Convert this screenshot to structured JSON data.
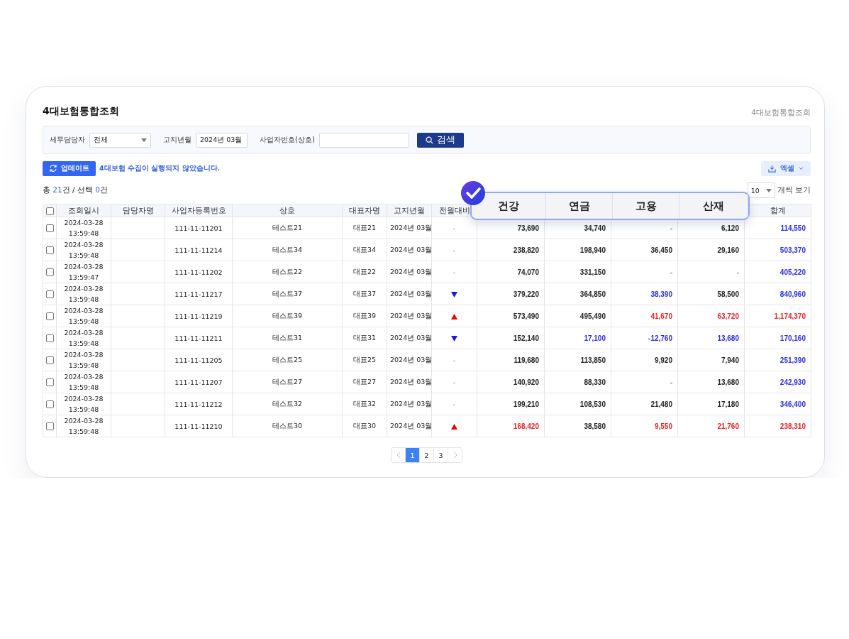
{
  "page": {
    "title": "4대보험통합조회",
    "breadcrumb": "4대보험통합조회"
  },
  "filters": {
    "manager": {
      "label": "세무담당자",
      "value": "전체"
    },
    "month": {
      "label": "고지년월",
      "value": "2024년 03월"
    },
    "business": {
      "label": "사업자번호(상호)"
    },
    "search_button": "검색"
  },
  "update_button": "업데이트",
  "status_message": "4대보험 수집이 실행되지 않았습니다.",
  "excel_button": "엑셀",
  "count": [
    {
      "text": "총 ",
      "accent": false
    },
    {
      "text": "21",
      "accent": true
    },
    {
      "text": "건 / 선택 ",
      "accent": false
    },
    {
      "text": "0",
      "accent": true
    },
    {
      "text": "건",
      "accent": false
    }
  ],
  "page_size": {
    "value": "10",
    "label": "개씩 보기"
  },
  "table": {
    "select_all_checked": false,
    "columns": [
      "조회일시",
      "담당자명",
      "사업자등록번호",
      "상호",
      "대표자명",
      "고지년월",
      "전월대비",
      "합계"
    ],
    "highlight_columns": [
      "건강",
      "연금",
      "고용",
      "산재"
    ],
    "rows": [
      {
        "checked": false,
        "date": "2024-03-28",
        "time": "13:59:48",
        "biz_no": "111-11-11201",
        "company": "테스트21",
        "ceo": "대표21",
        "month": "2024년 03월",
        "trend": {
          "kind": "flat",
          "text": "-"
        },
        "values": [
          {
            "text": "73,690",
            "color": "#222222"
          },
          {
            "text": "34,740",
            "color": "#222222"
          },
          {
            "text": "-"
          },
          {
            "text": "6,120",
            "color": "#222222"
          },
          {
            "text": "114,550",
            "color": "#2a2fd6"
          }
        ]
      },
      {
        "checked": false,
        "date": "2024-03-28",
        "time": "13:59:48",
        "biz_no": "111-11-11214",
        "company": "테스트34",
        "ceo": "대표34",
        "month": "2024년 03월",
        "trend": {
          "kind": "flat",
          "text": "-"
        },
        "values": [
          {
            "text": "238,820",
            "color": "#222222"
          },
          {
            "text": "198,940",
            "color": "#222222"
          },
          {
            "text": "36,450",
            "color": "#222222"
          },
          {
            "text": "29,160",
            "color": "#222222"
          },
          {
            "text": "503,370",
            "color": "#2a2fd6"
          }
        ]
      },
      {
        "checked": false,
        "date": "2024-03-28",
        "time": "13:59:47",
        "biz_no": "111-11-11202",
        "company": "테스트22",
        "ceo": "대표22",
        "month": "2024년 03월",
        "trend": {
          "kind": "flat",
          "text": "-"
        },
        "values": [
          {
            "text": "74,070",
            "color": "#222222"
          },
          {
            "text": "331,150",
            "color": "#222222"
          },
          {
            "text": "-"
          },
          {
            "text": "-"
          },
          {
            "text": "405,220",
            "color": "#2a2fd6"
          }
        ]
      },
      {
        "checked": false,
        "date": "2024-03-28",
        "time": "13:59:48",
        "biz_no": "111-11-11217",
        "company": "테스트37",
        "ceo": "대표37",
        "month": "2024년 03월",
        "trend": {
          "kind": "down"
        },
        "values": [
          {
            "text": "379,220",
            "color": "#222222"
          },
          {
            "text": "364,850",
            "color": "#222222"
          },
          {
            "text": "38,390",
            "color": "#2a2fd6"
          },
          {
            "text": "58,500",
            "color": "#222222"
          },
          {
            "text": "840,960",
            "color": "#2a2fd6"
          }
        ]
      },
      {
        "checked": false,
        "date": "2024-03-28",
        "time": "13:59:48",
        "biz_no": "111-11-11219",
        "company": "테스트39",
        "ceo": "대표39",
        "month": "2024년 03월",
        "trend": {
          "kind": "up"
        },
        "values": [
          {
            "text": "573,490",
            "color": "#222222"
          },
          {
            "text": "495,490",
            "color": "#222222"
          },
          {
            "text": "41,670",
            "color": "#e0262b"
          },
          {
            "text": "63,720",
            "color": "#e0262b"
          },
          {
            "text": "1,174,370",
            "color": "#e0262b"
          }
        ]
      },
      {
        "checked": false,
        "date": "2024-03-28",
        "time": "13:59:48",
        "biz_no": "111-11-11211",
        "company": "테스트31",
        "ceo": "대표31",
        "month": "2024년 03월",
        "trend": {
          "kind": "down"
        },
        "values": [
          {
            "text": "152,140",
            "color": "#222222"
          },
          {
            "text": "17,100",
            "color": "#2a2fd6"
          },
          {
            "text": "-12,760",
            "color": "#2a2fd6"
          },
          {
            "text": "13,680",
            "color": "#2a2fd6"
          },
          {
            "text": "170,160",
            "color": "#2a2fd6"
          }
        ]
      },
      {
        "checked": false,
        "date": "2024-03-28",
        "time": "13:59:48",
        "biz_no": "111-11-11205",
        "company": "테스트25",
        "ceo": "대표25",
        "month": "2024년 03월",
        "trend": {
          "kind": "flat",
          "text": "-"
        },
        "values": [
          {
            "text": "119,680",
            "color": "#222222"
          },
          {
            "text": "113,850",
            "color": "#222222"
          },
          {
            "text": "9,920",
            "color": "#222222"
          },
          {
            "text": "7,940",
            "color": "#222222"
          },
          {
            "text": "251,390",
            "color": "#2a2fd6"
          }
        ]
      },
      {
        "checked": false,
        "date": "2024-03-28",
        "time": "13:59:48",
        "biz_no": "111-11-11207",
        "company": "테스트27",
        "ceo": "대표27",
        "month": "2024년 03월",
        "trend": {
          "kind": "flat",
          "text": "-"
        },
        "values": [
          {
            "text": "140,920",
            "color": "#222222"
          },
          {
            "text": "88,330",
            "color": "#222222"
          },
          {
            "text": "-"
          },
          {
            "text": "13,680",
            "color": "#222222"
          },
          {
            "text": "242,930",
            "color": "#2a2fd6"
          }
        ]
      },
      {
        "checked": false,
        "date": "2024-03-28",
        "time": "13:59:48",
        "biz_no": "111-11-11212",
        "company": "테스트32",
        "ceo": "대표32",
        "month": "2024년 03월",
        "trend": {
          "kind": "flat",
          "text": "-"
        },
        "values": [
          {
            "text": "199,210",
            "color": "#222222"
          },
          {
            "text": "108,530",
            "color": "#222222"
          },
          {
            "text": "21,480",
            "color": "#222222"
          },
          {
            "text": "17,180",
            "color": "#222222"
          },
          {
            "text": "346,400",
            "color": "#2a2fd6"
          }
        ]
      },
      {
        "checked": false,
        "date": "2024-03-28",
        "time": "13:59:48",
        "biz_no": "111-11-11210",
        "company": "테스트30",
        "ceo": "대표30",
        "month": "2024년 03월",
        "trend": {
          "kind": "up"
        },
        "values": [
          {
            "text": "168,420",
            "color": "#e0262b"
          },
          {
            "text": "38,580",
            "color": "#222222"
          },
          {
            "text": "9,550",
            "color": "#e0262b"
          },
          {
            "text": "21,760",
            "color": "#e0262b"
          },
          {
            "text": "238,310",
            "color": "#e0262b"
          }
        ]
      }
    ]
  },
  "pagination": {
    "pages": [
      {
        "label": "1",
        "selected": true
      },
      {
        "label": "2",
        "selected": false
      },
      {
        "label": "3",
        "selected": false
      }
    ]
  }
}
